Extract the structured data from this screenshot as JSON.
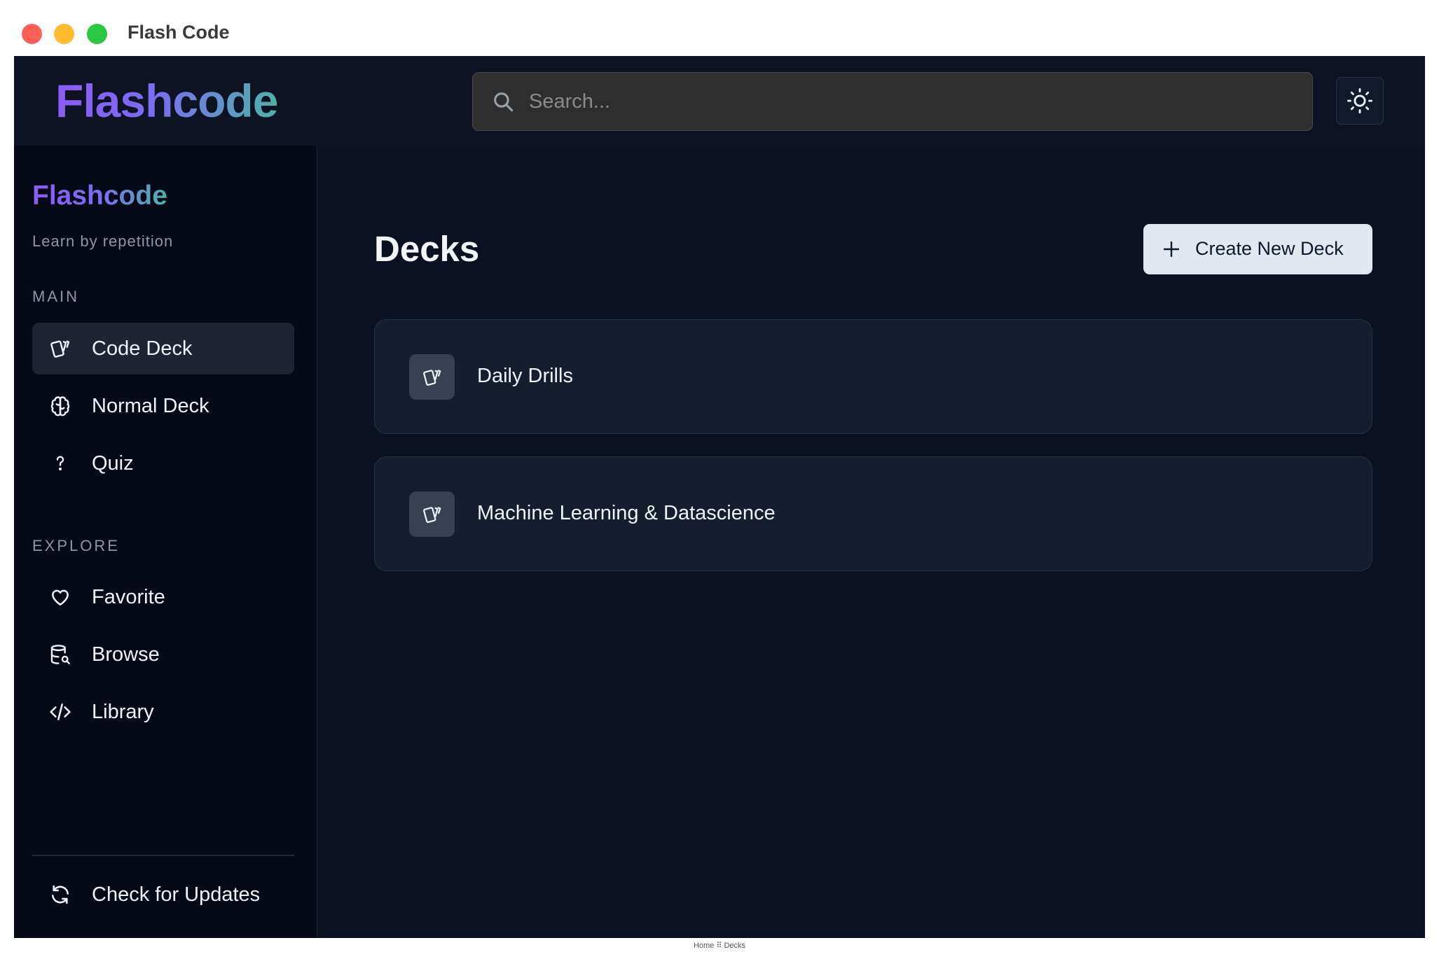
{
  "window": {
    "title": "Flash Code"
  },
  "header": {
    "brand": "Flashcode",
    "search": {
      "placeholder": "Search...",
      "value": ""
    },
    "theme_toggle_icon": "sun-icon"
  },
  "sidebar": {
    "brand": "Flashcode",
    "tagline": "Learn by repetition",
    "sections": [
      {
        "title": "MAIN",
        "items": [
          {
            "label": "Code Deck",
            "icon": "cards-icon",
            "active": true
          },
          {
            "label": "Normal Deck",
            "icon": "brain-icon",
            "active": false
          },
          {
            "label": "Quiz",
            "icon": "question-icon",
            "active": false
          }
        ]
      },
      {
        "title": "EXPLORE",
        "items": [
          {
            "label": "Favorite",
            "icon": "heart-icon",
            "active": false
          },
          {
            "label": "Browse",
            "icon": "database-search-icon",
            "active": false
          },
          {
            "label": "Library",
            "icon": "code-icon",
            "active": false
          }
        ]
      }
    ],
    "footer_item": {
      "label": "Check for Updates",
      "icon": "refresh-icon"
    }
  },
  "main": {
    "title": "Decks",
    "create_button": "Create New Deck",
    "decks": [
      {
        "name": "Daily Drills",
        "icon": "cards-icon"
      },
      {
        "name": "Machine Learning & Datascience",
        "icon": "cards-icon"
      }
    ]
  },
  "breadcrumb": "Home ⠿ Decks",
  "colors": {
    "background": "#0b1120",
    "sidebar": "#060a17",
    "card": "#151d2e",
    "brand_gradient_start": "#8b5cf6",
    "brand_gradient_end": "#4db3a8",
    "primary_button": "#e2e8f0"
  }
}
